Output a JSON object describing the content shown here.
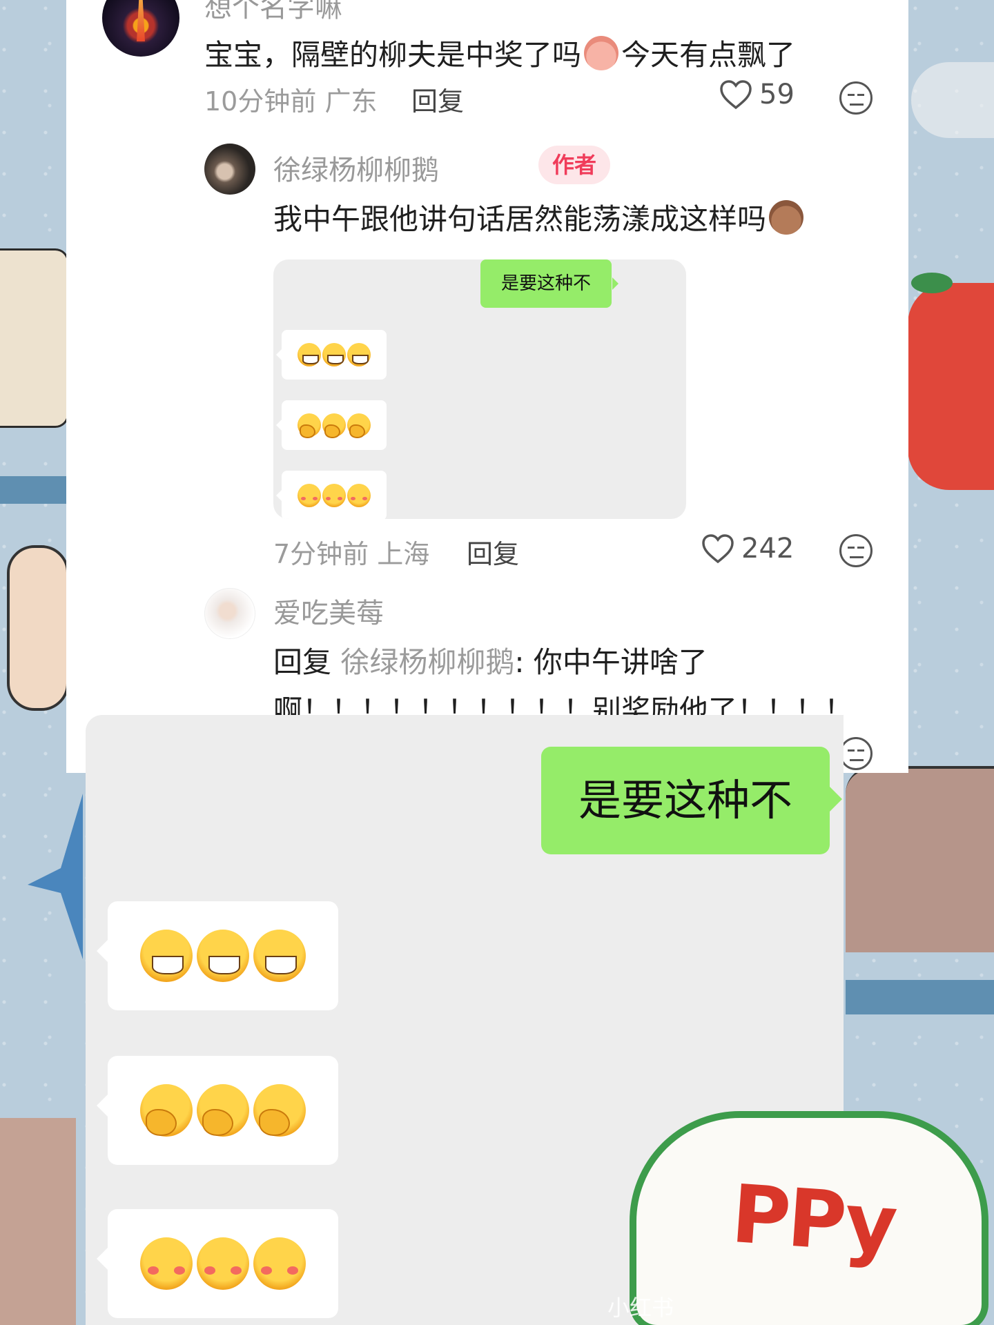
{
  "top_comment": {
    "username": "想个名字嘛",
    "text_before_emoji": "宝宝，隔壁的柳夫是中奖了吗",
    "text_after_emoji": "今天有点飘了",
    "time": "10分钟前",
    "location": "广东",
    "reply_label": "回复",
    "likes": "59"
  },
  "author_reply": {
    "username": "徐绿杨柳柳鹅",
    "badge": "作者",
    "text": "我中午跟他讲句话居然能荡漾成这样吗",
    "time": "7分钟前",
    "location": "上海",
    "reply_label": "回复",
    "likes": "242",
    "chat_image": {
      "green_bubble": "是要这种不",
      "rows": [
        "grin",
        "cover-mouth",
        "shy-smile"
      ]
    }
  },
  "sub_reply": {
    "username": "爱吃美莓",
    "reply_prefix": "回复",
    "reply_to": "徐绿杨柳柳鹅",
    "text_line1": ": 你中午讲啥了",
    "text_line2": "啊！！！！！！！！！！别奖励他了！！！！"
  },
  "big_chat": {
    "green_bubble": "是要这种不"
  },
  "sticker_text": "PPy",
  "watermark": "小红书",
  "colors": {
    "author_badge_bg": "#fde6e9",
    "author_badge_text": "#f03c5a",
    "wechat_green": "#95ec69"
  }
}
